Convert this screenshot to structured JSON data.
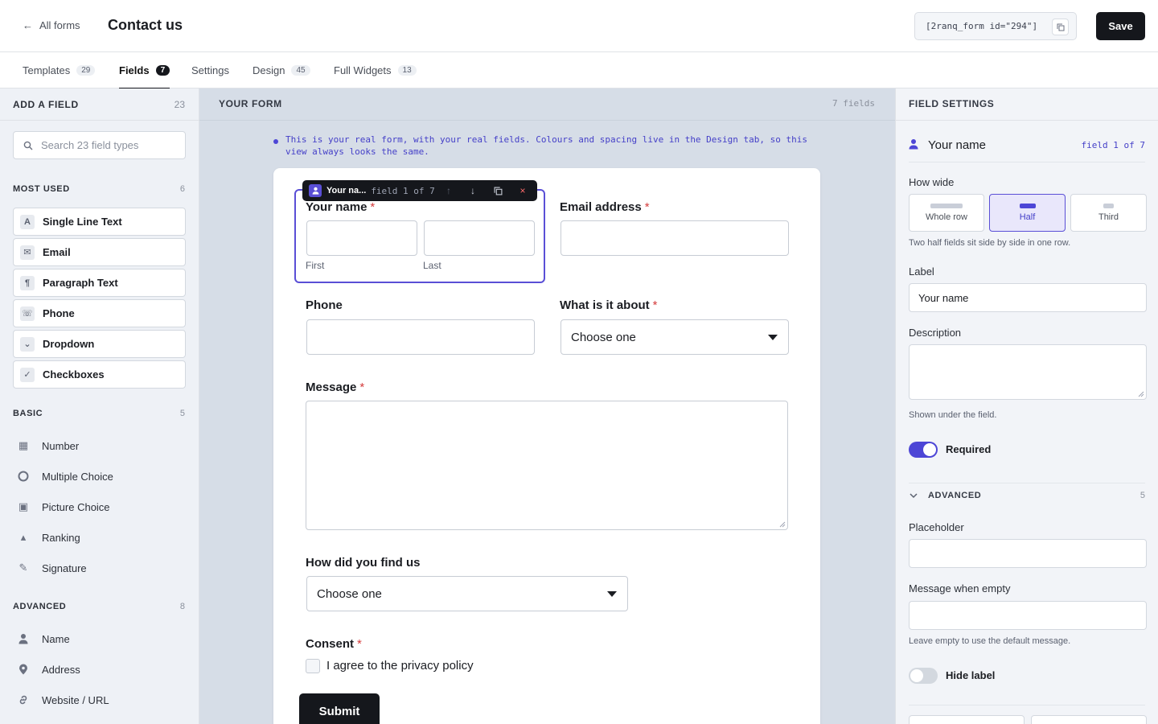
{
  "header": {
    "back_label": "All forms",
    "back_arrow": "←",
    "title": "Contact us",
    "shortcode": "[2ranq_form id=\"294\"]",
    "save_label": "Save"
  },
  "tabs": [
    {
      "label": "Templates",
      "count": "29"
    },
    {
      "label": "Fields",
      "count": "7"
    },
    {
      "label": "Settings",
      "count": ""
    },
    {
      "label": "Design",
      "count": "45"
    },
    {
      "label": "Full Widgets",
      "count": "13"
    }
  ],
  "active_tab": "Fields",
  "left": {
    "title": "ADD A FIELD",
    "count": "23",
    "search_placeholder": "Search 23 field types",
    "most_used": {
      "title": "MOST USED",
      "count": "6",
      "items": [
        {
          "label": "Single Line Text",
          "icon": "A"
        },
        {
          "label": "Email",
          "icon": "✉"
        },
        {
          "label": "Paragraph Text",
          "icon": "¶"
        },
        {
          "label": "Phone",
          "icon": "☏"
        },
        {
          "label": "Dropdown",
          "icon": "⌄"
        },
        {
          "label": "Checkboxes",
          "icon": "✓"
        }
      ]
    },
    "basic": {
      "title": "BASIC",
      "count": "5",
      "items": [
        {
          "label": "Number",
          "icon": "▦"
        },
        {
          "label": "Multiple Choice",
          "icon": "○"
        },
        {
          "label": "Picture Choice",
          "icon": "▣"
        },
        {
          "label": "Ranking",
          "icon": "▴"
        },
        {
          "label": "Signature",
          "icon": "✎"
        }
      ]
    },
    "advanced": {
      "title": "ADVANCED",
      "count": "8",
      "items": [
        {
          "label": "Name",
          "icon": "person"
        },
        {
          "label": "Address",
          "icon": "pin"
        },
        {
          "label": "Website / URL",
          "icon": "link"
        }
      ]
    }
  },
  "center": {
    "title": "YOUR FORM",
    "count": "7 fields",
    "notice": "This is your real form, with your real fields. Colours and spacing live in the Design tab, so this view always looks the same.",
    "toolbar": {
      "name": "Your na...",
      "count": "field 1 of 7"
    },
    "fields": {
      "name_label": "Your name",
      "first_sub": "First",
      "last_sub": "Last",
      "email_label": "Email address",
      "phone_label": "Phone",
      "about_label": "What is it about",
      "about_value": "Choose one",
      "message_label": "Message",
      "find_label": "How did you find us",
      "find_value": "Choose one",
      "consent_label": "Consent",
      "consent_text": "I agree to the privacy policy",
      "required_mark": "*"
    },
    "submit_label": "Submit"
  },
  "right": {
    "title": "FIELD SETTINGS",
    "selected_name": "Your name",
    "selected_count": "field 1 of 7",
    "how_wide_label": "How wide",
    "width_options": [
      "Whole row",
      "Half",
      "Third"
    ],
    "width_selected": "Half",
    "width_hint": "Two half fields sit side by side in one row.",
    "label_label": "Label",
    "label_value": "Your name",
    "description_label": "Description",
    "description_value": "",
    "description_hint": "Shown under the field.",
    "required_label": "Required",
    "required_on": true,
    "advanced_title": "ADVANCED",
    "advanced_count": "5",
    "placeholder_label": "Placeholder",
    "placeholder_value": "",
    "empty_msg_label": "Message when empty",
    "empty_msg_value": "",
    "empty_msg_hint": "Leave empty to use the default message.",
    "hide_label": "Hide label",
    "hide_label_on": false
  },
  "colors": {
    "accent": "#4d46d6",
    "dark": "#15171c",
    "required": "#d43b3b"
  }
}
